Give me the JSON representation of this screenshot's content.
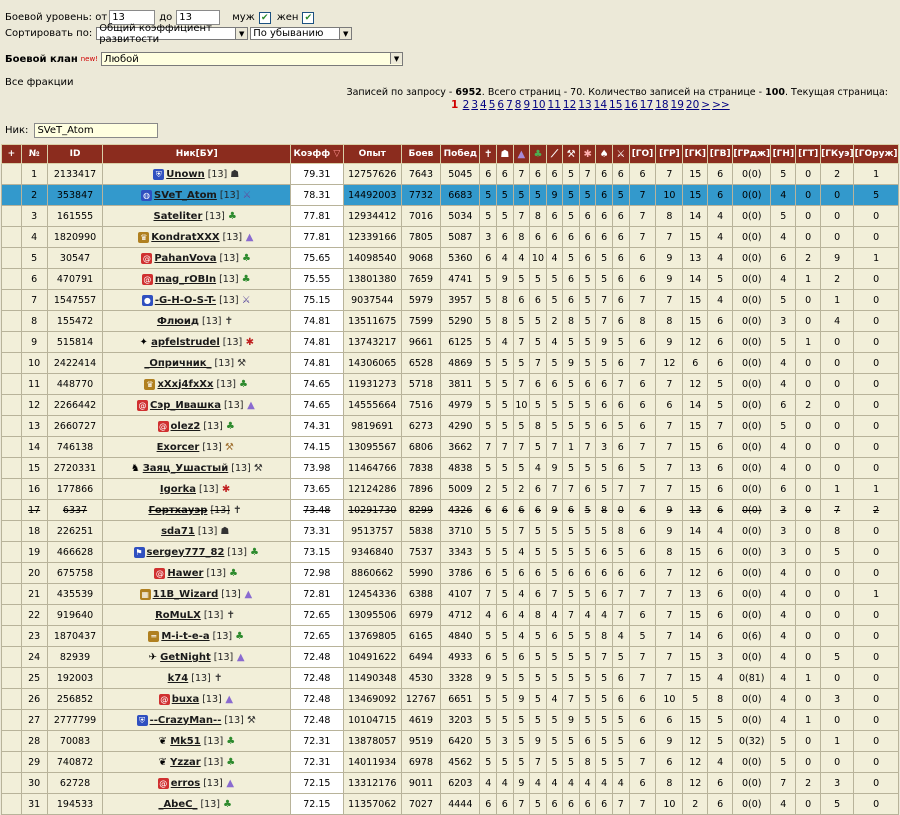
{
  "filters": {
    "level_label": "Боевой уровень: от",
    "level_from": "13",
    "level_to_label": "до",
    "level_to": "13",
    "male_label": "муж",
    "female_label": "жен",
    "sort_label": "Сортировать по:",
    "sort_field": "Общий коэффициент развитости",
    "sort_order": "По убыванию",
    "clan_label": "Боевой клан",
    "new_badge": "new!",
    "clan_value": "Любой",
    "factions_label": "Все фракции",
    "nick_label": "Ник:",
    "nick_value": "SVeT_Atom"
  },
  "summary": {
    "t1": "Записей по запросу - ",
    "records": "6952",
    "t2": ". Всего страниц - 70. Количество записей на странице - ",
    "per_page": "100",
    "t3": ". Текущая страница:"
  },
  "pagination": {
    "current": "1",
    "pages": [
      "2",
      "3",
      "4",
      "5",
      "6",
      "7",
      "8",
      "9",
      "10",
      "11",
      "12",
      "13",
      "14",
      "15",
      "16",
      "17",
      "18",
      "19",
      "20"
    ],
    "next": ">",
    "last": ">>"
  },
  "table": {
    "headers": {
      "expand": "+",
      "num": "№",
      "id": "ID",
      "nick": "Ник[БУ]",
      "koef": "Коэфф",
      "exp": "Опыт",
      "battles": "Боев",
      "wins": "Побед",
      "go": "[ГО]",
      "gr": "[ГР]",
      "gk": "[ГК]",
      "gv": "[ГВ]",
      "grd": "[ГРдж]",
      "gn": "[ГН]",
      "gt": "[ГТ]",
      "gku": "[ГКуэ]",
      "gor": "[ГОруж]"
    },
    "header_icons": [
      "cross-icon",
      "helmet-icon",
      "hat-icon",
      "leaf-icon",
      "feather-icon",
      "wrench-icon",
      "bug-icon",
      "mushroom-icon"
    ],
    "rows": [
      {
        "n": "1",
        "id": "2133417",
        "nick": "Unown",
        "lvl": "[13]",
        "clan": "shield",
        "cls": "helmet",
        "koef": "79.31",
        "exp": "12757626",
        "b": "7643",
        "w": "5045",
        "s": [
          "6",
          "6",
          "7",
          "6",
          "6",
          "5",
          "7",
          "6",
          "6"
        ],
        "go": "6",
        "gr": "7",
        "gk": "15",
        "gv": "6",
        "grd": "0(0)",
        "gn": "5",
        "gt": "0",
        "gku": "2",
        "gor": "1"
      },
      {
        "n": "2",
        "id": "353847",
        "nick": "SVeT_Atom",
        "lvl": "[13]",
        "clan": "globe",
        "cls": "sword",
        "koef": "78.31",
        "exp": "14492003",
        "b": "7732",
        "w": "6683",
        "s": [
          "5",
          "5",
          "5",
          "5",
          "9",
          "5",
          "5",
          "6",
          "5"
        ],
        "go": "7",
        "gr": "10",
        "gk": "15",
        "gv": "6",
        "grd": "0(0)",
        "gn": "4",
        "gt": "0",
        "gku": "0",
        "gor": "5",
        "selected": true
      },
      {
        "n": "3",
        "id": "161555",
        "nick": "Sateliter",
        "lvl": "[13]",
        "clan": "",
        "cls": "leaf",
        "koef": "77.81",
        "exp": "12934412",
        "b": "7016",
        "w": "5034",
        "s": [
          "5",
          "5",
          "7",
          "8",
          "6",
          "5",
          "6",
          "6",
          "6"
        ],
        "go": "7",
        "gr": "8",
        "gk": "14",
        "gv": "4",
        "grd": "0(0)",
        "gn": "5",
        "gt": "0",
        "gku": "0",
        "gor": "0"
      },
      {
        "n": "4",
        "id": "1820990",
        "nick": "KondratXXX",
        "lvl": "[13]",
        "clan": "gold",
        "cls": "hat",
        "koef": "77.81",
        "exp": "12339166",
        "b": "7805",
        "w": "5087",
        "s": [
          "3",
          "6",
          "8",
          "6",
          "6",
          "6",
          "6",
          "6",
          "6"
        ],
        "go": "7",
        "gr": "7",
        "gk": "15",
        "gv": "4",
        "grd": "0(0)",
        "gn": "4",
        "gt": "0",
        "gku": "0",
        "gor": "0"
      },
      {
        "n": "5",
        "id": "30547",
        "nick": "PahanVova",
        "lvl": "[13]",
        "clan": "red",
        "cls": "leaf",
        "koef": "75.65",
        "exp": "14098540",
        "b": "9068",
        "w": "5360",
        "s": [
          "6",
          "4",
          "4",
          "10",
          "4",
          "5",
          "6",
          "5",
          "6"
        ],
        "go": "6",
        "gr": "9",
        "gk": "13",
        "gv": "4",
        "grd": "0(0)",
        "gn": "6",
        "gt": "2",
        "gku": "9",
        "gor": "1"
      },
      {
        "n": "6",
        "id": "470791",
        "nick": "mag_rOBIn",
        "lvl": "[13]",
        "clan": "red",
        "cls": "leaf",
        "koef": "75.55",
        "exp": "13801380",
        "b": "7659",
        "w": "4741",
        "s": [
          "5",
          "9",
          "5",
          "5",
          "5",
          "6",
          "5",
          "5",
          "6"
        ],
        "go": "6",
        "gr": "9",
        "gk": "14",
        "gv": "5",
        "grd": "0(0)",
        "gn": "4",
        "gt": "1",
        "gku": "2",
        "gor": "0"
      },
      {
        "n": "7",
        "id": "1547557",
        "nick": "-G-H-O-S-T-",
        "lvl": "[13]",
        "clan": "blue",
        "cls": "sword",
        "koef": "75.15",
        "exp": "9037544",
        "b": "5979",
        "w": "3957",
        "s": [
          "5",
          "8",
          "6",
          "6",
          "5",
          "6",
          "5",
          "7",
          "6"
        ],
        "go": "7",
        "gr": "7",
        "gk": "15",
        "gv": "4",
        "grd": "0(0)",
        "gn": "5",
        "gt": "0",
        "gku": "1",
        "gor": "0"
      },
      {
        "n": "8",
        "id": "155472",
        "nick": "Флюид",
        "lvl": "[13]",
        "clan": "",
        "cls": "cross",
        "koef": "74.81",
        "exp": "13511675",
        "b": "7599",
        "w": "5290",
        "s": [
          "5",
          "8",
          "5",
          "5",
          "2",
          "8",
          "5",
          "7",
          "6"
        ],
        "go": "8",
        "gr": "8",
        "gk": "15",
        "gv": "6",
        "grd": "0(0)",
        "gn": "3",
        "gt": "0",
        "gku": "4",
        "gor": "0"
      },
      {
        "n": "9",
        "id": "515814",
        "nick": "apfelstrudel",
        "lvl": "[13]",
        "clan": "star",
        "cls": "bug",
        "koef": "74.81",
        "exp": "13743217",
        "b": "9661",
        "w": "6125",
        "s": [
          "5",
          "4",
          "7",
          "5",
          "4",
          "5",
          "5",
          "9",
          "5"
        ],
        "go": "6",
        "gr": "9",
        "gk": "12",
        "gv": "6",
        "grd": "0(0)",
        "gn": "5",
        "gt": "1",
        "gku": "0",
        "gor": "0"
      },
      {
        "n": "10",
        "id": "2422414",
        "nick": "_Опричник_",
        "lvl": "[13]",
        "clan": "",
        "cls": "wrench",
        "koef": "74.81",
        "exp": "14306065",
        "b": "6528",
        "w": "4869",
        "s": [
          "5",
          "5",
          "5",
          "7",
          "5",
          "9",
          "5",
          "5",
          "6"
        ],
        "go": "7",
        "gr": "12",
        "gk": "6",
        "gv": "6",
        "grd": "0(0)",
        "gn": "4",
        "gt": "0",
        "gku": "0",
        "gor": "0"
      },
      {
        "n": "11",
        "id": "448770",
        "nick": "xXxj4fxXx",
        "lvl": "[13]",
        "clan": "gold",
        "cls": "leaf",
        "koef": "74.65",
        "exp": "11931273",
        "b": "5718",
        "w": "3811",
        "s": [
          "5",
          "5",
          "7",
          "6",
          "6",
          "5",
          "6",
          "6",
          "7"
        ],
        "go": "6",
        "gr": "7",
        "gk": "12",
        "gv": "5",
        "grd": "0(0)",
        "gn": "4",
        "gt": "0",
        "gku": "0",
        "gor": "0"
      },
      {
        "n": "12",
        "id": "2266442",
        "nick": "Сэр_Ивашка",
        "lvl": "[13]",
        "clan": "red",
        "cls": "hat",
        "koef": "74.65",
        "exp": "14555664",
        "b": "7516",
        "w": "4979",
        "s": [
          "5",
          "5",
          "10",
          "5",
          "5",
          "5",
          "5",
          "6",
          "6"
        ],
        "go": "6",
        "gr": "6",
        "gk": "14",
        "gv": "5",
        "grd": "0(0)",
        "gn": "6",
        "gt": "2",
        "gku": "0",
        "gor": "0"
      },
      {
        "n": "13",
        "id": "2660727",
        "nick": "olez2",
        "lvl": "[13]",
        "clan": "red",
        "cls": "leaf",
        "koef": "74.31",
        "exp": "9819691",
        "b": "6273",
        "w": "4290",
        "s": [
          "5",
          "5",
          "5",
          "8",
          "5",
          "5",
          "5",
          "6",
          "5"
        ],
        "go": "6",
        "gr": "7",
        "gk": "15",
        "gv": "7",
        "grd": "0(0)",
        "gn": "5",
        "gt": "0",
        "gku": "0",
        "gor": "0"
      },
      {
        "n": "14",
        "id": "746138",
        "nick": "Exorcer",
        "lvl": "[13]",
        "clan": "",
        "cls": "hammer",
        "koef": "74.15",
        "exp": "13095567",
        "b": "6806",
        "w": "3662",
        "s": [
          "7",
          "7",
          "7",
          "5",
          "7",
          "1",
          "7",
          "3",
          "6"
        ],
        "go": "7",
        "gr": "7",
        "gk": "15",
        "gv": "6",
        "grd": "0(0)",
        "gn": "4",
        "gt": "0",
        "gku": "0",
        "gor": "0"
      },
      {
        "n": "15",
        "id": "2720331",
        "nick": "Заяц_Ушастый",
        "lvl": "[13]",
        "clan": "rabbit",
        "cls": "wrench",
        "koef": "73.98",
        "exp": "11464766",
        "b": "7838",
        "w": "4838",
        "s": [
          "5",
          "5",
          "5",
          "4",
          "9",
          "5",
          "5",
          "5",
          "6"
        ],
        "go": "5",
        "gr": "7",
        "gk": "13",
        "gv": "6",
        "grd": "0(0)",
        "gn": "4",
        "gt": "0",
        "gku": "0",
        "gor": "0"
      },
      {
        "n": "16",
        "id": "177866",
        "nick": "Igorka",
        "lvl": "[13]",
        "clan": "",
        "cls": "bug",
        "koef": "73.65",
        "exp": "12124286",
        "b": "7896",
        "w": "5009",
        "s": [
          "2",
          "5",
          "2",
          "6",
          "7",
          "7",
          "6",
          "5",
          "7"
        ],
        "go": "7",
        "gr": "7",
        "gk": "15",
        "gv": "6",
        "grd": "0(0)",
        "gn": "6",
        "gt": "0",
        "gku": "1",
        "gor": "1"
      },
      {
        "n": "17",
        "id": "6337",
        "nick": "Гортхауэр",
        "lvl": "[13]",
        "clan": "",
        "cls": "cross",
        "koef": "73.48",
        "exp": "10291730",
        "b": "8299",
        "w": "4326",
        "s": [
          "6",
          "6",
          "6",
          "6",
          "9",
          "6",
          "5",
          "8",
          "0"
        ],
        "go": "6",
        "gr": "9",
        "gk": "13",
        "gv": "6",
        "grd": "0(0)",
        "gn": "3",
        "gt": "0",
        "gku": "7",
        "gor": "2",
        "struck": true
      },
      {
        "n": "18",
        "id": "226251",
        "nick": "sda71",
        "lvl": "[13]",
        "clan": "",
        "cls": "helmet",
        "koef": "73.31",
        "exp": "9513757",
        "b": "5838",
        "w": "3710",
        "s": [
          "5",
          "5",
          "7",
          "5",
          "5",
          "5",
          "5",
          "5",
          "8"
        ],
        "go": "6",
        "gr": "9",
        "gk": "14",
        "gv": "4",
        "grd": "0(0)",
        "gn": "3",
        "gt": "0",
        "gku": "8",
        "gor": "0"
      },
      {
        "n": "19",
        "id": "466628",
        "nick": "sergey777_82",
        "lvl": "[13]",
        "clan": "flag",
        "cls": "leaf",
        "koef": "73.15",
        "exp": "9346840",
        "b": "7537",
        "w": "3343",
        "s": [
          "5",
          "5",
          "4",
          "5",
          "5",
          "5",
          "5",
          "6",
          "5"
        ],
        "go": "6",
        "gr": "8",
        "gk": "15",
        "gv": "6",
        "grd": "0(0)",
        "gn": "3",
        "gt": "0",
        "gku": "5",
        "gor": "0"
      },
      {
        "n": "20",
        "id": "675758",
        "nick": "Hawer",
        "lvl": "[13]",
        "clan": "red",
        "cls": "leaf",
        "koef": "72.98",
        "exp": "8860662",
        "b": "5990",
        "w": "3786",
        "s": [
          "6",
          "5",
          "6",
          "6",
          "5",
          "6",
          "6",
          "6",
          "6"
        ],
        "go": "6",
        "gr": "7",
        "gk": "12",
        "gv": "6",
        "grd": "0(0)",
        "gn": "4",
        "gt": "0",
        "gku": "0",
        "gor": "0"
      },
      {
        "n": "21",
        "id": "435539",
        "nick": "11B_Wizard",
        "lvl": "[13]",
        "clan": "rainbow",
        "cls": "hat",
        "koef": "72.81",
        "exp": "12454336",
        "b": "6388",
        "w": "4107",
        "s": [
          "7",
          "5",
          "4",
          "6",
          "7",
          "5",
          "5",
          "6",
          "7"
        ],
        "go": "7",
        "gr": "7",
        "gk": "13",
        "gv": "6",
        "grd": "0(0)",
        "gn": "4",
        "gt": "0",
        "gku": "0",
        "gor": "1"
      },
      {
        "n": "22",
        "id": "919640",
        "nick": "RoMuLX",
        "lvl": "[13]",
        "clan": "",
        "cls": "cross",
        "koef": "72.65",
        "exp": "13095506",
        "b": "6979",
        "w": "4712",
        "s": [
          "4",
          "6",
          "4",
          "8",
          "4",
          "7",
          "4",
          "4",
          "7"
        ],
        "go": "6",
        "gr": "7",
        "gk": "15",
        "gv": "6",
        "grd": "0(0)",
        "gn": "4",
        "gt": "0",
        "gku": "0",
        "gor": "0"
      },
      {
        "n": "23",
        "id": "1870437",
        "nick": "M-i-t-e-a",
        "lvl": "[13]",
        "clan": "stripe",
        "cls": "leaf",
        "koef": "72.65",
        "exp": "13769805",
        "b": "6165",
        "w": "4840",
        "s": [
          "5",
          "5",
          "4",
          "5",
          "6",
          "5",
          "5",
          "8",
          "4"
        ],
        "go": "5",
        "gr": "7",
        "gk": "14",
        "gv": "6",
        "grd": "0(6)",
        "gn": "4",
        "gt": "0",
        "gku": "0",
        "gor": "0"
      },
      {
        "n": "24",
        "id": "82939",
        "nick": "GetNight",
        "lvl": "[13]",
        "clan": "bird",
        "cls": "hat",
        "koef": "72.48",
        "exp": "10491622",
        "b": "6494",
        "w": "4933",
        "s": [
          "6",
          "5",
          "6",
          "5",
          "5",
          "5",
          "5",
          "7",
          "5"
        ],
        "go": "7",
        "gr": "7",
        "gk": "15",
        "gv": "3",
        "grd": "0(0)",
        "gn": "4",
        "gt": "0",
        "gku": "5",
        "gor": "0"
      },
      {
        "n": "25",
        "id": "192003",
        "nick": "k74",
        "lvl": "[13]",
        "clan": "",
        "cls": "cross",
        "koef": "72.48",
        "exp": "11490348",
        "b": "4530",
        "w": "3328",
        "s": [
          "9",
          "5",
          "5",
          "5",
          "5",
          "5",
          "5",
          "5",
          "6"
        ],
        "go": "7",
        "gr": "7",
        "gk": "15",
        "gv": "4",
        "grd": "0(81)",
        "gn": "4",
        "gt": "1",
        "gku": "0",
        "gor": "0"
      },
      {
        "n": "26",
        "id": "256852",
        "nick": "buxa",
        "lvl": "[13]",
        "clan": "red",
        "cls": "hat",
        "koef": "72.48",
        "exp": "13469092",
        "b": "12767",
        "w": "6651",
        "s": [
          "5",
          "5",
          "9",
          "5",
          "4",
          "7",
          "5",
          "5",
          "6"
        ],
        "go": "6",
        "gr": "10",
        "gk": "5",
        "gv": "8",
        "grd": "0(0)",
        "gn": "4",
        "gt": "0",
        "gku": "3",
        "gor": "0"
      },
      {
        "n": "27",
        "id": "2777799",
        "nick": "--CrazyMan--",
        "lvl": "[13]",
        "clan": "shield",
        "cls": "wrench",
        "koef": "72.48",
        "exp": "10104715",
        "b": "4619",
        "w": "3203",
        "s": [
          "5",
          "5",
          "5",
          "5",
          "5",
          "9",
          "5",
          "5",
          "5"
        ],
        "go": "6",
        "gr": "6",
        "gk": "15",
        "gv": "5",
        "grd": "0(0)",
        "gn": "4",
        "gt": "1",
        "gku": "0",
        "gor": "0"
      },
      {
        "n": "28",
        "id": "70083",
        "nick": "Mk51",
        "lvl": "[13]",
        "clan": "wings",
        "cls": "leaf",
        "koef": "72.31",
        "exp": "13878057",
        "b": "9519",
        "w": "6420",
        "s": [
          "5",
          "3",
          "5",
          "9",
          "5",
          "5",
          "6",
          "5",
          "5"
        ],
        "go": "6",
        "gr": "9",
        "gk": "12",
        "gv": "5",
        "grd": "0(32)",
        "gn": "5",
        "gt": "0",
        "gku": "1",
        "gor": "0"
      },
      {
        "n": "29",
        "id": "740872",
        "nick": "Yzzar",
        "lvl": "[13]",
        "clan": "wings",
        "cls": "leaf",
        "koef": "72.31",
        "exp": "14011934",
        "b": "6978",
        "w": "4562",
        "s": [
          "5",
          "5",
          "5",
          "7",
          "5",
          "5",
          "8",
          "5",
          "5"
        ],
        "go": "7",
        "gr": "6",
        "gk": "12",
        "gv": "4",
        "grd": "0(0)",
        "gn": "5",
        "gt": "0",
        "gku": "0",
        "gor": "0"
      },
      {
        "n": "30",
        "id": "62728",
        "nick": "erros",
        "lvl": "[13]",
        "clan": "red",
        "cls": "hat",
        "koef": "72.15",
        "exp": "13312176",
        "b": "9011",
        "w": "6203",
        "s": [
          "4",
          "4",
          "9",
          "4",
          "4",
          "4",
          "4",
          "4",
          "4"
        ],
        "go": "6",
        "gr": "8",
        "gk": "12",
        "gv": "6",
        "grd": "0(0)",
        "gn": "7",
        "gt": "2",
        "gku": "3",
        "gor": "0"
      },
      {
        "n": "31",
        "id": "194533",
        "nick": "_AbeC_",
        "lvl": "[13]",
        "clan": "",
        "cls": "leaf",
        "koef": "72.15",
        "exp": "11357062",
        "b": "7027",
        "w": "4444",
        "s": [
          "6",
          "6",
          "7",
          "5",
          "6",
          "6",
          "6",
          "6",
          "7"
        ],
        "go": "7",
        "gr": "10",
        "gk": "2",
        "gv": "6",
        "grd": "0(0)",
        "gn": "4",
        "gt": "0",
        "gku": "5",
        "gor": "0"
      }
    ]
  }
}
